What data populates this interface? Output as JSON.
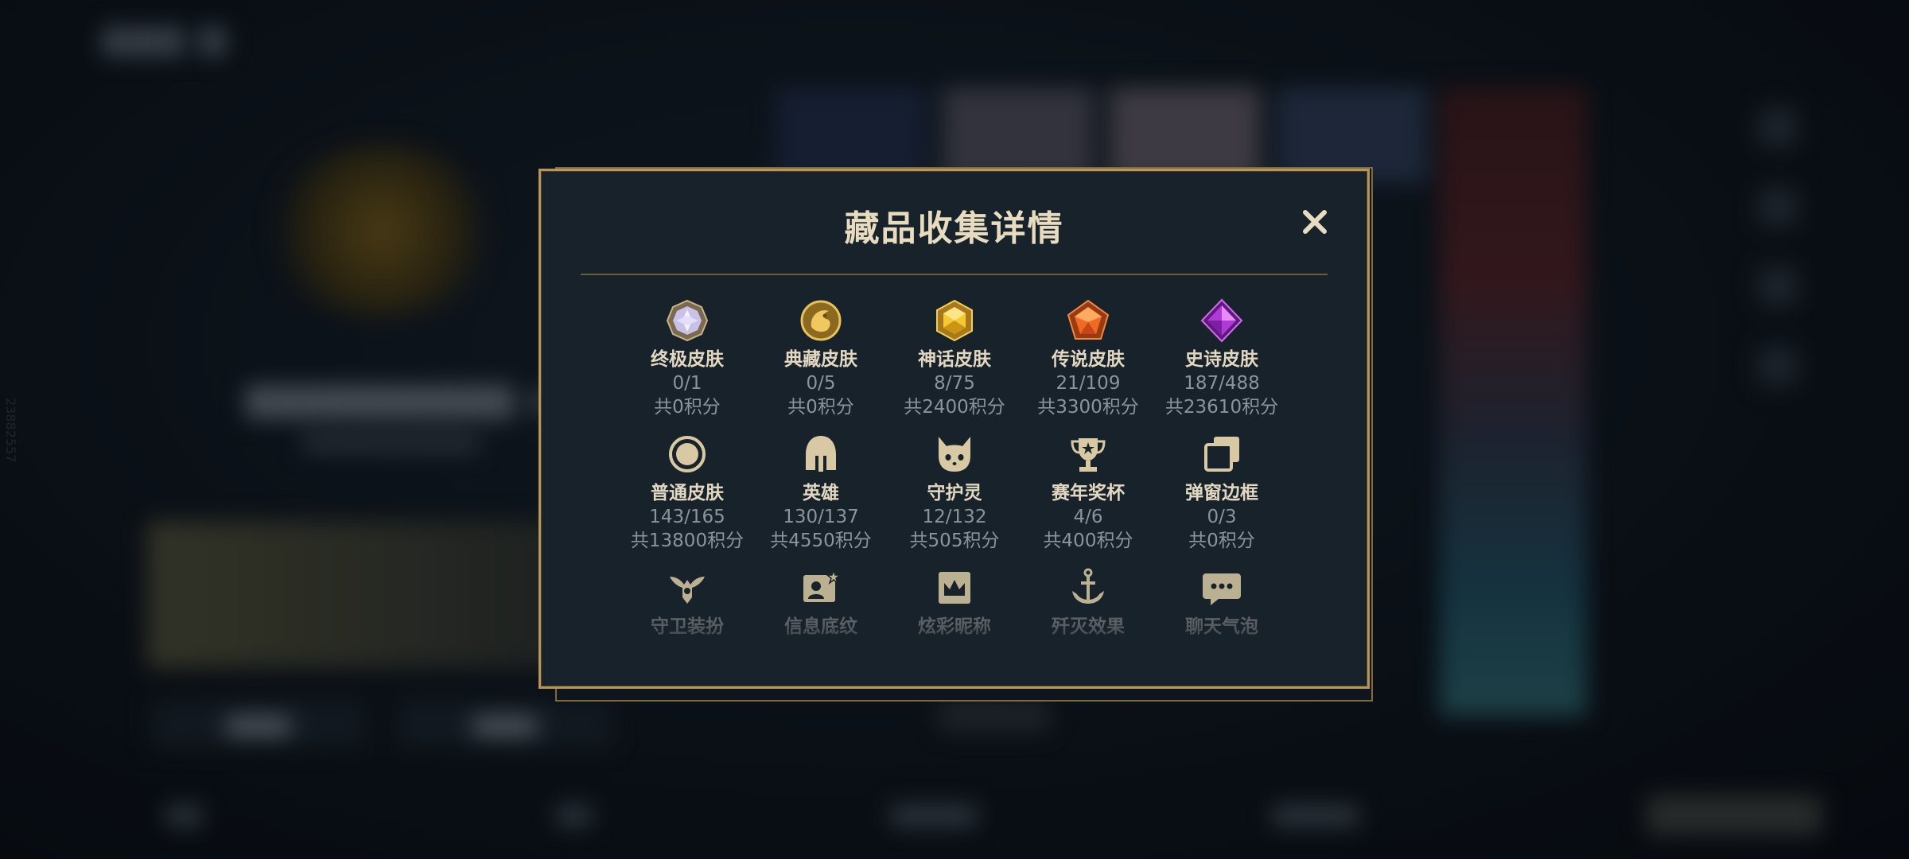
{
  "modal": {
    "title": "藏品收集详情",
    "close_icon": "close-icon"
  },
  "categories": [
    {
      "name": "终极皮肤",
      "count": "0/1",
      "points": "共0积分",
      "icon": "ultimate-gem-icon"
    },
    {
      "name": "典藏皮肤",
      "count": "0/5",
      "points": "共0积分",
      "icon": "dragon-emblem-icon"
    },
    {
      "name": "神话皮肤",
      "count": "8/75",
      "points": "共2400积分",
      "icon": "gold-hexagon-gem-icon"
    },
    {
      "name": "传说皮肤",
      "count": "21/109",
      "points": "共3300积分",
      "icon": "orange-pentagon-gem-icon"
    },
    {
      "name": "史诗皮肤",
      "count": "187/488",
      "points": "共23610积分",
      "icon": "purple-diamond-gem-icon"
    },
    {
      "name": "普通皮肤",
      "count": "143/165",
      "points": "共13800积分",
      "icon": "ring-icon"
    },
    {
      "name": "英雄",
      "count": "130/137",
      "points": "共4550积分",
      "icon": "helmet-icon"
    },
    {
      "name": "守护灵",
      "count": "12/132",
      "points": "共505积分",
      "icon": "guardian-pet-icon"
    },
    {
      "name": "赛年奖杯",
      "count": "4/6",
      "points": "共400积分",
      "icon": "trophy-icon"
    },
    {
      "name": "弹窗边框",
      "count": "0/3",
      "points": "共0积分",
      "icon": "frame-stack-icon"
    },
    {
      "name": "守卫装扮",
      "icon": "ward-skin-icon"
    },
    {
      "name": "信息底纹",
      "icon": "profile-card-icon"
    },
    {
      "name": "炫彩昵称",
      "icon": "crown-nameplate-icon"
    },
    {
      "name": "歼灭效果",
      "icon": "anchor-effect-icon"
    },
    {
      "name": "聊天气泡",
      "icon": "chat-bubble-icon"
    }
  ],
  "background": {
    "vertical_id": "23882557"
  },
  "colors": {
    "modal_border": "#b8955a",
    "modal_bg": "#18222b",
    "title": "#e8dcc0",
    "muted_text": "#8b949b",
    "divider": "#6d5c38"
  }
}
